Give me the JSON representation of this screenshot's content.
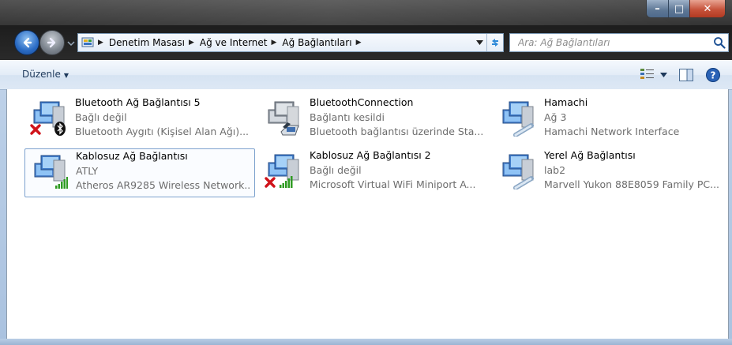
{
  "window": {
    "minimize": "–",
    "maximize": "□",
    "close": "✕"
  },
  "address": {
    "crumbs": [
      "Denetim Masası",
      "Ağ ve Internet",
      "Ağ Bağlantıları"
    ],
    "icon": "control-panel-icon"
  },
  "search": {
    "placeholder": "Ara: Ağ Bağlantıları"
  },
  "toolbar": {
    "organize_label": "Düzenle"
  },
  "connections": [
    {
      "name": "Bluetooth Ağ Bağlantısı 5",
      "status": "Bağlı değil",
      "device": "Bluetooth Aygıtı (Kişisel Alan Ağı)...",
      "icon": "bluetooth-network-icon",
      "overlay": "disconnected-x-icon"
    },
    {
      "name": "BluetoothConnection",
      "status": "Bağlantı kesildi",
      "device": "Bluetooth bağlantısı üzerinde Sta...",
      "icon": "dialup-modem-icon",
      "overlay": "phone-icon"
    },
    {
      "name": "Hamachi",
      "status": "Ağ  3",
      "device": "Hamachi Network Interface",
      "icon": "wired-network-icon",
      "overlay": "network-cable-icon"
    },
    {
      "name": "Kablosuz Ağ Bağlantısı",
      "status": "ATLY",
      "device": "Atheros AR9285 Wireless Network...",
      "icon": "wireless-network-icon",
      "overlay": "signal-bars-icon"
    },
    {
      "name": "Kablosuz Ağ Bağlantısı 2",
      "status": "Bağlı değil",
      "device": "Microsoft Virtual WiFi Miniport A...",
      "icon": "wireless-network-icon",
      "overlay": "disconnected-x-icon"
    },
    {
      "name": "Yerel Ağ Bağlantısı",
      "status": "lab2",
      "device": "Marvell Yukon 88E8059 Family PC...",
      "icon": "wired-network-icon",
      "overlay": "network-cable-icon"
    }
  ],
  "colors": {
    "accent": "#2a6bc4",
    "selection_border": "#7da2ce",
    "error_red": "#d0131a",
    "signal_green": "#2f9b22"
  }
}
